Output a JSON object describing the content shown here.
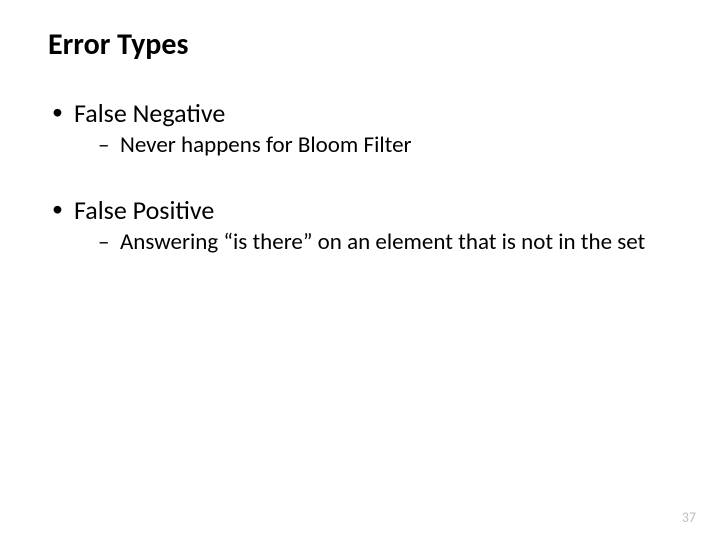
{
  "slide": {
    "title": "Error Types",
    "bullets": [
      {
        "label": "False Negative",
        "sub": [
          "Never happens for Bloom Filter"
        ]
      },
      {
        "label": "False Positive",
        "sub": [
          "Answering “is there” on an element that is not in the set"
        ]
      }
    ],
    "page_number": "37"
  }
}
